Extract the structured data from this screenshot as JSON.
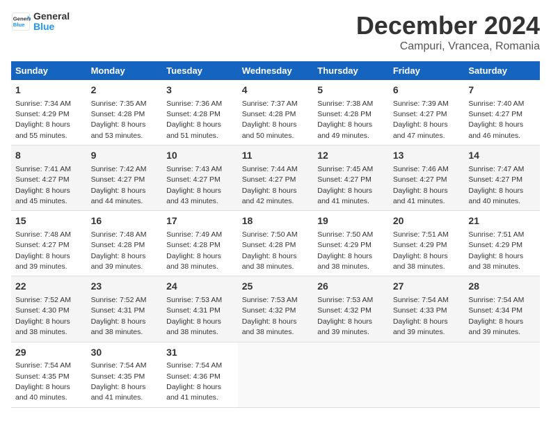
{
  "logo": {
    "line1": "General",
    "line2": "Blue"
  },
  "title": "December 2024",
  "subtitle": "Campuri, Vrancea, Romania",
  "days_of_week": [
    "Sunday",
    "Monday",
    "Tuesday",
    "Wednesday",
    "Thursday",
    "Friday",
    "Saturday"
  ],
  "weeks": [
    [
      {
        "day": "1",
        "sunrise": "7:34 AM",
        "sunset": "4:29 PM",
        "daylight": "8 hours and 55 minutes."
      },
      {
        "day": "2",
        "sunrise": "7:35 AM",
        "sunset": "4:28 PM",
        "daylight": "8 hours and 53 minutes."
      },
      {
        "day": "3",
        "sunrise": "7:36 AM",
        "sunset": "4:28 PM",
        "daylight": "8 hours and 51 minutes."
      },
      {
        "day": "4",
        "sunrise": "7:37 AM",
        "sunset": "4:28 PM",
        "daylight": "8 hours and 50 minutes."
      },
      {
        "day": "5",
        "sunrise": "7:38 AM",
        "sunset": "4:28 PM",
        "daylight": "8 hours and 49 minutes."
      },
      {
        "day": "6",
        "sunrise": "7:39 AM",
        "sunset": "4:27 PM",
        "daylight": "8 hours and 47 minutes."
      },
      {
        "day": "7",
        "sunrise": "7:40 AM",
        "sunset": "4:27 PM",
        "daylight": "8 hours and 46 minutes."
      }
    ],
    [
      {
        "day": "8",
        "sunrise": "7:41 AM",
        "sunset": "4:27 PM",
        "daylight": "8 hours and 45 minutes."
      },
      {
        "day": "9",
        "sunrise": "7:42 AM",
        "sunset": "4:27 PM",
        "daylight": "8 hours and 44 minutes."
      },
      {
        "day": "10",
        "sunrise": "7:43 AM",
        "sunset": "4:27 PM",
        "daylight": "8 hours and 43 minutes."
      },
      {
        "day": "11",
        "sunrise": "7:44 AM",
        "sunset": "4:27 PM",
        "daylight": "8 hours and 42 minutes."
      },
      {
        "day": "12",
        "sunrise": "7:45 AM",
        "sunset": "4:27 PM",
        "daylight": "8 hours and 41 minutes."
      },
      {
        "day": "13",
        "sunrise": "7:46 AM",
        "sunset": "4:27 PM",
        "daylight": "8 hours and 41 minutes."
      },
      {
        "day": "14",
        "sunrise": "7:47 AM",
        "sunset": "4:27 PM",
        "daylight": "8 hours and 40 minutes."
      }
    ],
    [
      {
        "day": "15",
        "sunrise": "7:48 AM",
        "sunset": "4:27 PM",
        "daylight": "8 hours and 39 minutes."
      },
      {
        "day": "16",
        "sunrise": "7:48 AM",
        "sunset": "4:28 PM",
        "daylight": "8 hours and 39 minutes."
      },
      {
        "day": "17",
        "sunrise": "7:49 AM",
        "sunset": "4:28 PM",
        "daylight": "8 hours and 38 minutes."
      },
      {
        "day": "18",
        "sunrise": "7:50 AM",
        "sunset": "4:28 PM",
        "daylight": "8 hours and 38 minutes."
      },
      {
        "day": "19",
        "sunrise": "7:50 AM",
        "sunset": "4:29 PM",
        "daylight": "8 hours and 38 minutes."
      },
      {
        "day": "20",
        "sunrise": "7:51 AM",
        "sunset": "4:29 PM",
        "daylight": "8 hours and 38 minutes."
      },
      {
        "day": "21",
        "sunrise": "7:51 AM",
        "sunset": "4:29 PM",
        "daylight": "8 hours and 38 minutes."
      }
    ],
    [
      {
        "day": "22",
        "sunrise": "7:52 AM",
        "sunset": "4:30 PM",
        "daylight": "8 hours and 38 minutes."
      },
      {
        "day": "23",
        "sunrise": "7:52 AM",
        "sunset": "4:31 PM",
        "daylight": "8 hours and 38 minutes."
      },
      {
        "day": "24",
        "sunrise": "7:53 AM",
        "sunset": "4:31 PM",
        "daylight": "8 hours and 38 minutes."
      },
      {
        "day": "25",
        "sunrise": "7:53 AM",
        "sunset": "4:32 PM",
        "daylight": "8 hours and 38 minutes."
      },
      {
        "day": "26",
        "sunrise": "7:53 AM",
        "sunset": "4:32 PM",
        "daylight": "8 hours and 39 minutes."
      },
      {
        "day": "27",
        "sunrise": "7:54 AM",
        "sunset": "4:33 PM",
        "daylight": "8 hours and 39 minutes."
      },
      {
        "day": "28",
        "sunrise": "7:54 AM",
        "sunset": "4:34 PM",
        "daylight": "8 hours and 39 minutes."
      }
    ],
    [
      {
        "day": "29",
        "sunrise": "7:54 AM",
        "sunset": "4:35 PM",
        "daylight": "8 hours and 40 minutes."
      },
      {
        "day": "30",
        "sunrise": "7:54 AM",
        "sunset": "4:35 PM",
        "daylight": "8 hours and 41 minutes."
      },
      {
        "day": "31",
        "sunrise": "7:54 AM",
        "sunset": "4:36 PM",
        "daylight": "8 hours and 41 minutes."
      },
      null,
      null,
      null,
      null
    ]
  ],
  "labels": {
    "sunrise": "Sunrise:",
    "sunset": "Sunset:",
    "daylight": "Daylight:"
  }
}
